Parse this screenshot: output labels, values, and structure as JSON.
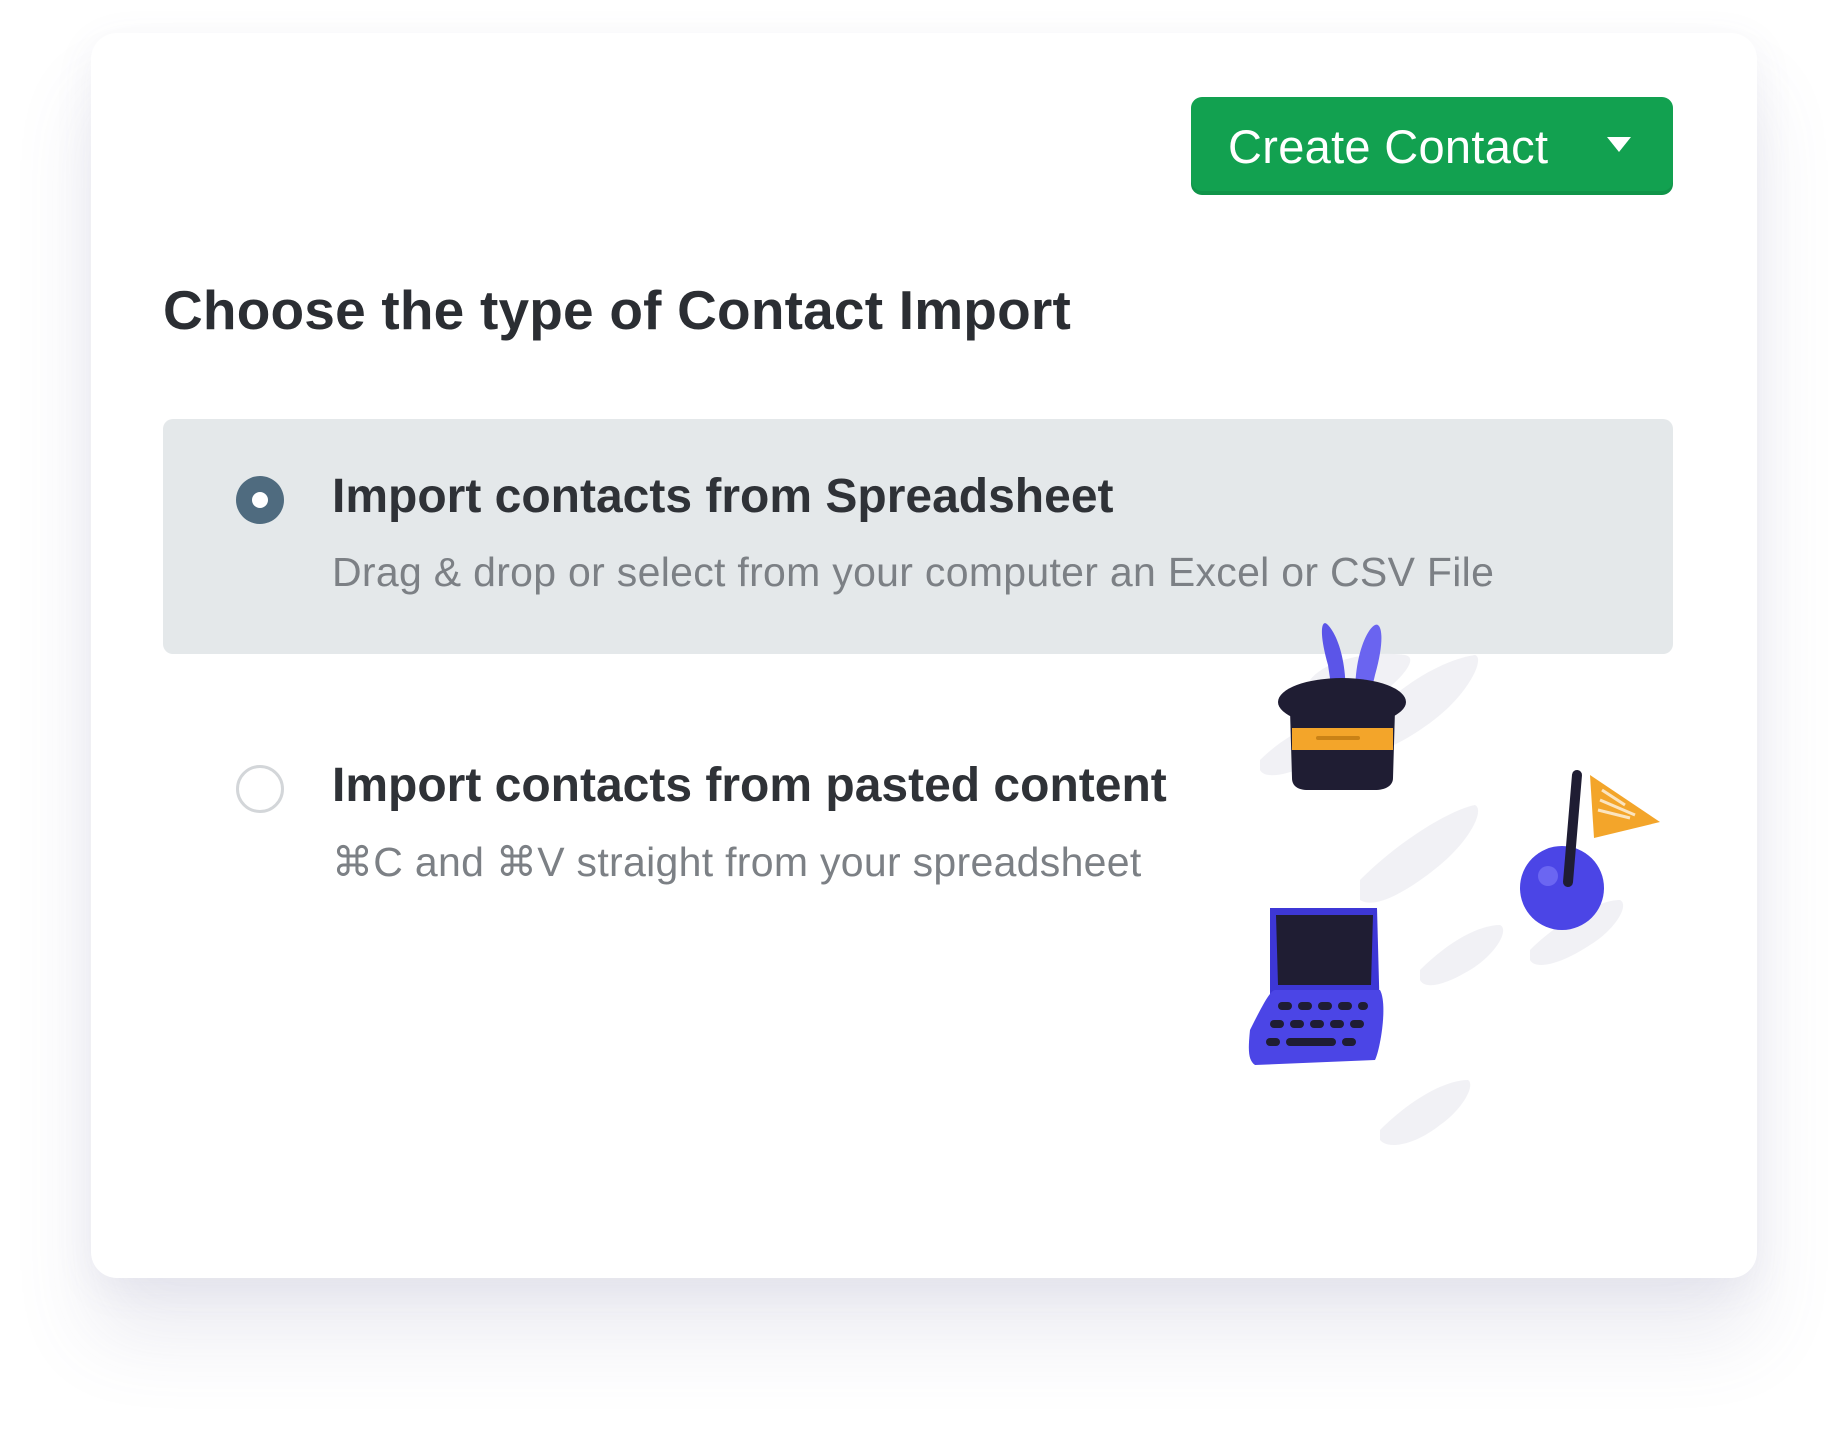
{
  "header": {
    "create_button_label": "Create Contact"
  },
  "import": {
    "heading": "Choose the type of Contact Import",
    "options": [
      {
        "title": "Import contacts from Spreadsheet",
        "description": "Drag & drop or select from your computer an Excel or CSV File",
        "selected": true
      },
      {
        "title": "Import contacts from pasted content",
        "description": "⌘C and ⌘V straight from your spreadsheet",
        "selected": false
      }
    ]
  },
  "colors": {
    "primary_button": "#12a150",
    "selected_option_bg": "#e4e8ea",
    "radio_selected": "#4f6b7f",
    "illustration_purple": "#4b45e6",
    "illustration_orange": "#f3a52a"
  },
  "icons": {
    "button_caret": "caret-down-icon",
    "illustration_items": [
      "magic-hat-icon",
      "bomb-flag-icon",
      "laptop-icon"
    ]
  }
}
